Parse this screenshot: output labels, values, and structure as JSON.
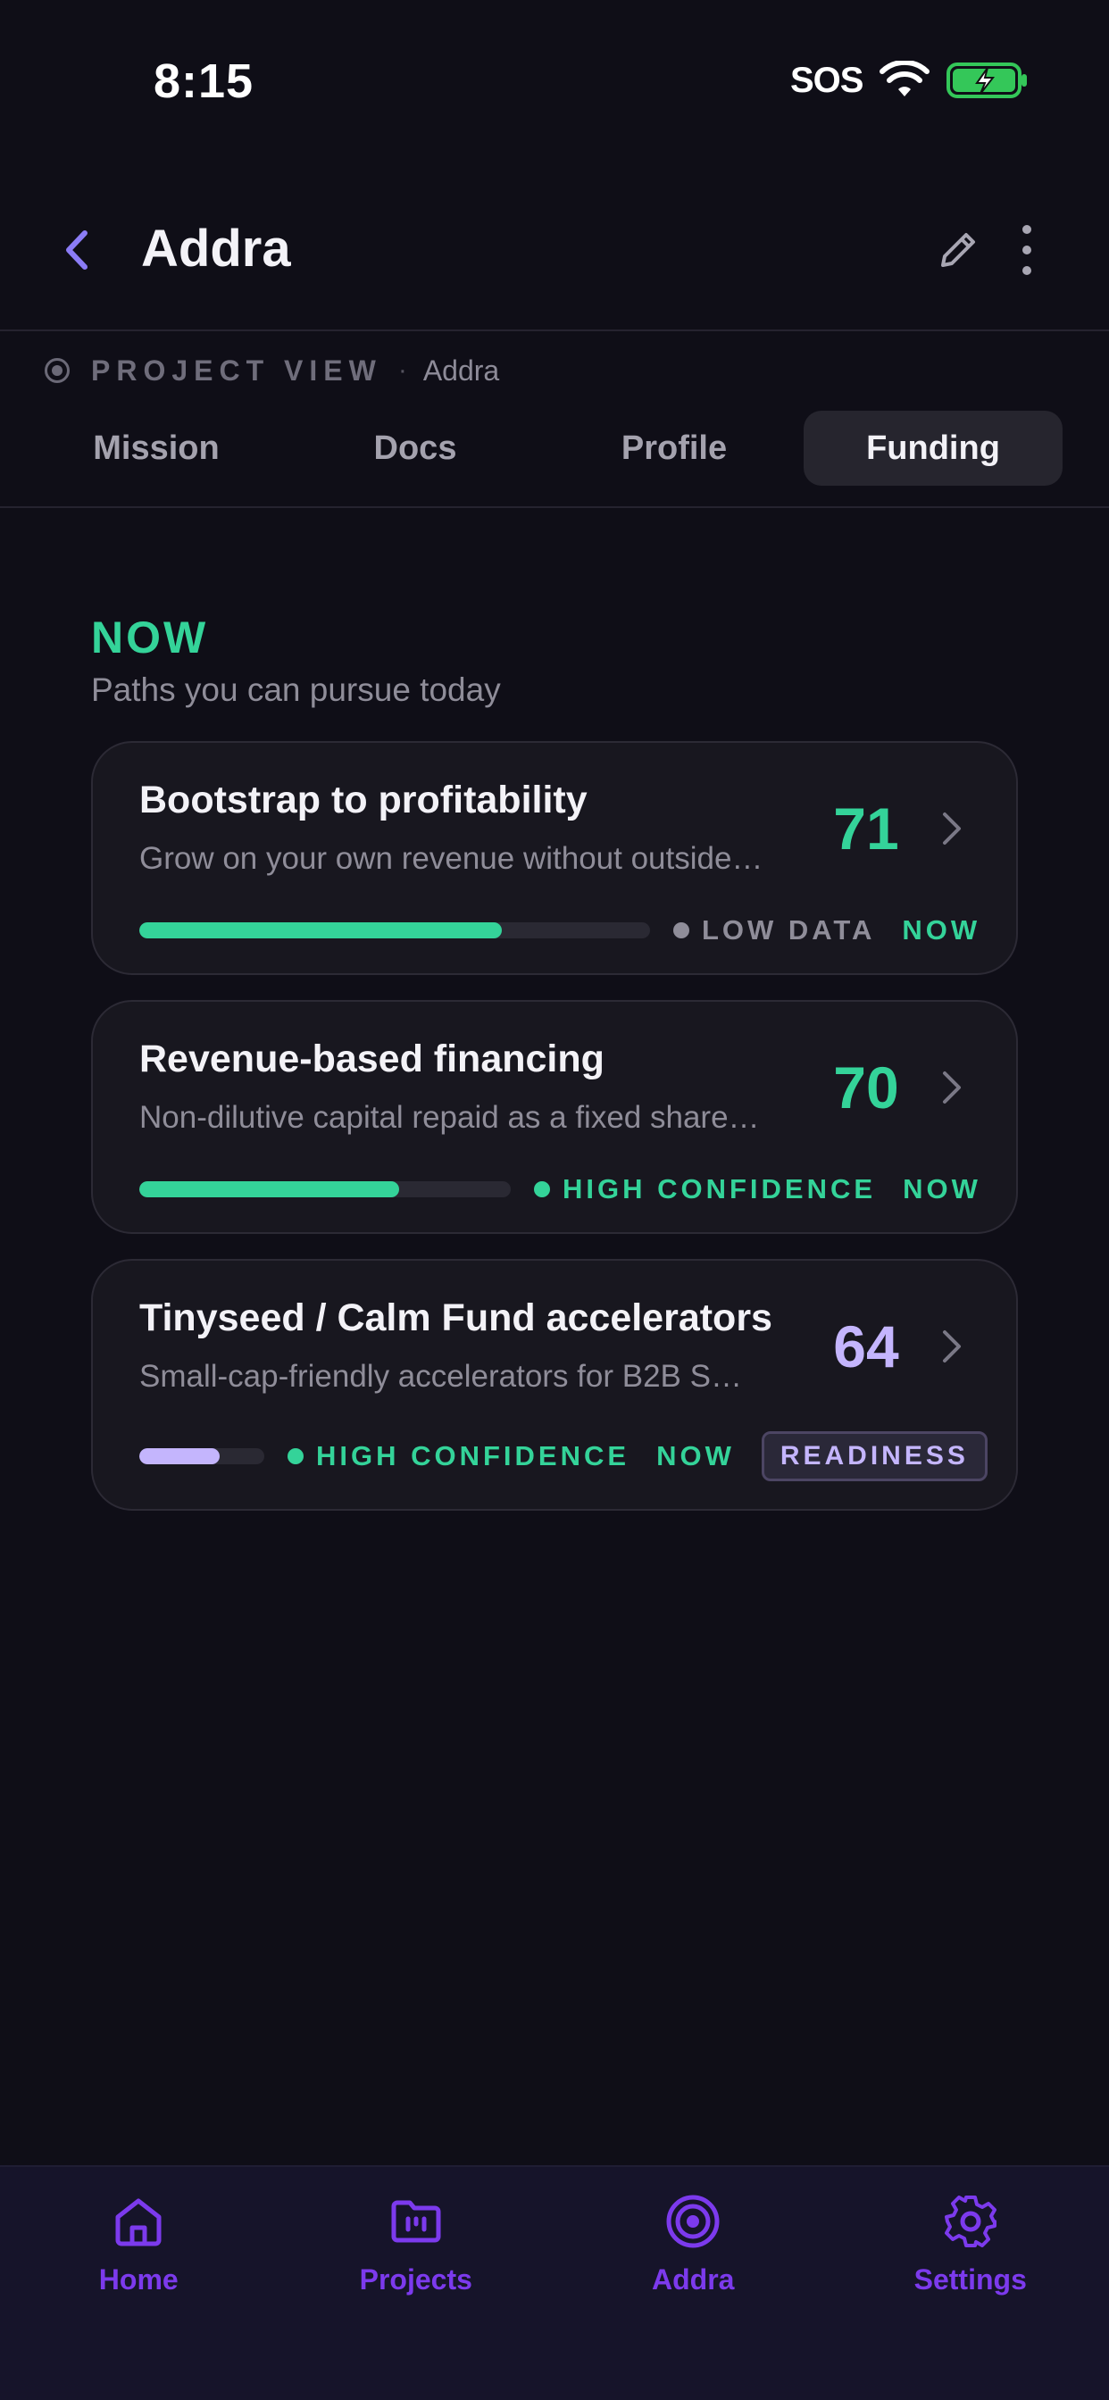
{
  "status_bar": {
    "time": "8:15",
    "sos": "SOS"
  },
  "header": {
    "title": "Addra"
  },
  "breadcrumb": {
    "label": "PROJECT VIEW",
    "separator": "·",
    "project": "Addra"
  },
  "tabs": [
    {
      "label": "Mission",
      "active": false
    },
    {
      "label": "Docs",
      "active": false
    },
    {
      "label": "Profile",
      "active": false
    },
    {
      "label": "Funding",
      "active": true
    }
  ],
  "section": {
    "title": "NOW",
    "subtitle": "Paths you can pursue today"
  },
  "cards": [
    {
      "title": "Bootstrap to profitability",
      "description": "Grow on your own revenue without outside…",
      "score": "71",
      "score_color": "#34d399",
      "progress": 0.71,
      "bar_color": "#34d399",
      "confidence": "LOW DATA",
      "confidence_color": "#8f8d99",
      "timing": "NOW"
    },
    {
      "title": "Revenue-based financing",
      "description": "Non-dilutive capital repaid as a fixed share…",
      "score": "70",
      "score_color": "#34d399",
      "progress": 0.7,
      "bar_color": "#34d399",
      "confidence": "HIGH CONFIDENCE",
      "confidence_color": "#34d399",
      "timing": "NOW"
    },
    {
      "title": "Tinyseed / Calm Fund accelerators",
      "description": "Small-cap-friendly accelerators for B2B S…",
      "score": "64",
      "score_color": "#c4b5fd",
      "progress": 0.64,
      "bar_color": "#c4b5fd",
      "confidence": "HIGH CONFIDENCE",
      "confidence_color": "#34d399",
      "timing": "NOW",
      "tag": "READINESS"
    }
  ],
  "bottom_nav": [
    {
      "label": "Home",
      "icon": "home-icon"
    },
    {
      "label": "Projects",
      "icon": "folder-icon"
    },
    {
      "label": "Addra",
      "icon": "target-icon"
    },
    {
      "label": "Settings",
      "icon": "gear-icon"
    }
  ],
  "colors": {
    "accent_green": "#34d399",
    "accent_purple": "#7c3aed",
    "light_purple": "#c4b5fd",
    "background": "#0f0e17"
  }
}
